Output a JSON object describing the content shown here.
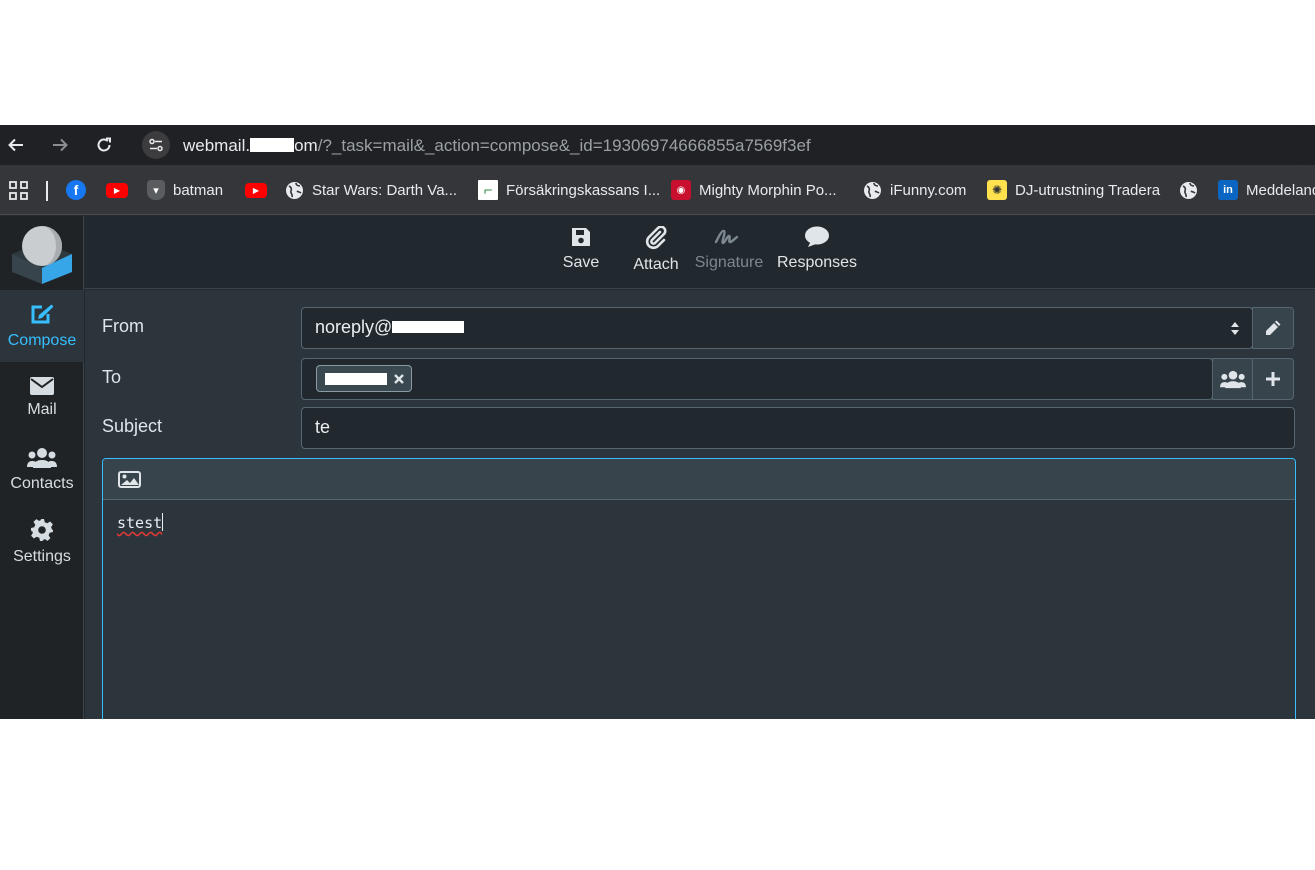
{
  "browser": {
    "url_host_prefix": "webmail.",
    "url_host_suffix": "om",
    "url_path": "/?_task=mail&_action=compose&_id=19306974666855a7569f3ef",
    "icons": [
      "back-arrow-icon",
      "forward-arrow-icon",
      "reload-icon",
      "site-settings-icon"
    ]
  },
  "bookmarks": [
    {
      "label": "",
      "icon": "apps-grid-icon"
    },
    {
      "label": "",
      "icon": "facebook-icon"
    },
    {
      "label": "",
      "icon": "youtube-icon"
    },
    {
      "label": "batman",
      "icon": "tank-icon"
    },
    {
      "label": "",
      "icon": "youtube-icon"
    },
    {
      "label": "Star Wars: Darth Va...",
      "icon": "globe-icon"
    },
    {
      "label": "Försäkringskassans I...",
      "icon": "fk-logo-icon"
    },
    {
      "label": "Mighty Morphin Po...",
      "icon": "power-rangers-icon"
    },
    {
      "label": "iFunny.com",
      "icon": "globe-icon"
    },
    {
      "label": "DJ-utrustning Tradera",
      "icon": "tradera-icon"
    },
    {
      "label": "",
      "icon": "globe-icon"
    },
    {
      "label": "Meddeland",
      "icon": "linkedin-icon"
    }
  ],
  "nav": {
    "compose": "Compose",
    "mail": "Mail",
    "contacts": "Contacts",
    "settings": "Settings"
  },
  "toolbar": {
    "save": "Save",
    "attach": "Attach",
    "signature": "Signature",
    "responses": "Responses"
  },
  "compose": {
    "from_label": "From",
    "from_value": "noreply@",
    "to_label": "To",
    "subject_label": "Subject",
    "subject_value": "te",
    "body_text": "stest"
  },
  "colors": {
    "accent": "#37beff",
    "background": "#22292e",
    "panel": "#2b353b"
  }
}
